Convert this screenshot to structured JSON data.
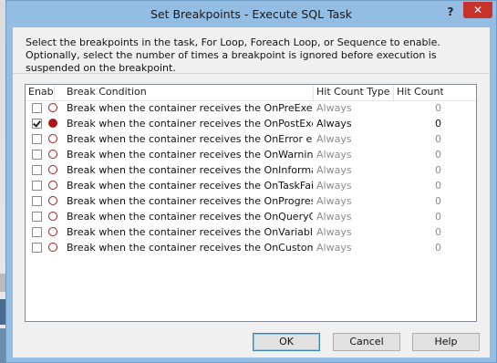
{
  "window": {
    "title": "Set Breakpoints - Execute SQL Task",
    "help_label": "?",
    "close_label": "✕"
  },
  "description": "Select the breakpoints in the task, For Loop, Foreach Loop, or Sequence to enable. Optionally, select the number of times a breakpoint is ignored before execution is suspended on the breakpoint.",
  "table": {
    "columns": [
      "Enab...",
      "Break Condition",
      "Hit Count Type",
      "Hit Count"
    ],
    "rows": [
      {
        "enabled": false,
        "condition": "Break when the container receives the OnPreExecute event",
        "hit_count_type": "Always",
        "hit_count": "0"
      },
      {
        "enabled": true,
        "condition": "Break when the container receives the OnPostExecute eve...",
        "hit_count_type": "Always",
        "hit_count": "0"
      },
      {
        "enabled": false,
        "condition": "Break when the container receives the OnError event",
        "hit_count_type": "Always",
        "hit_count": "0"
      },
      {
        "enabled": false,
        "condition": "Break when the container receives the OnWarning event",
        "hit_count_type": "Always",
        "hit_count": "0"
      },
      {
        "enabled": false,
        "condition": "Break when the container receives the OnInformation event",
        "hit_count_type": "Always",
        "hit_count": "0"
      },
      {
        "enabled": false,
        "condition": "Break when the container receives the OnTaskFailed event",
        "hit_count_type": "Always",
        "hit_count": "0"
      },
      {
        "enabled": false,
        "condition": "Break when the container receives the OnProgress event",
        "hit_count_type": "Always",
        "hit_count": "0"
      },
      {
        "enabled": false,
        "condition": "Break when the container receives the OnQueryCancel ev...",
        "hit_count_type": "Always",
        "hit_count": "0"
      },
      {
        "enabled": false,
        "condition": "Break when the container receives the OnVariableValueC...",
        "hit_count_type": "Always",
        "hit_count": "0"
      },
      {
        "enabled": false,
        "condition": "Break when the container receives the OnCustomEvent ev...",
        "hit_count_type": "Always",
        "hit_count": "0"
      }
    ]
  },
  "buttons": {
    "ok": "OK",
    "cancel": "Cancel",
    "help": "Help"
  },
  "colors": {
    "title_bar": "#93bde3",
    "close_button": "#c7322b",
    "breakpoint_active": "#b5121b",
    "breakpoint_outline": "#9a2020"
  },
  "icons": {
    "row_breakpoint": "breakpoint-circle-icon",
    "close": "close-icon",
    "help": "question-mark-icon"
  }
}
